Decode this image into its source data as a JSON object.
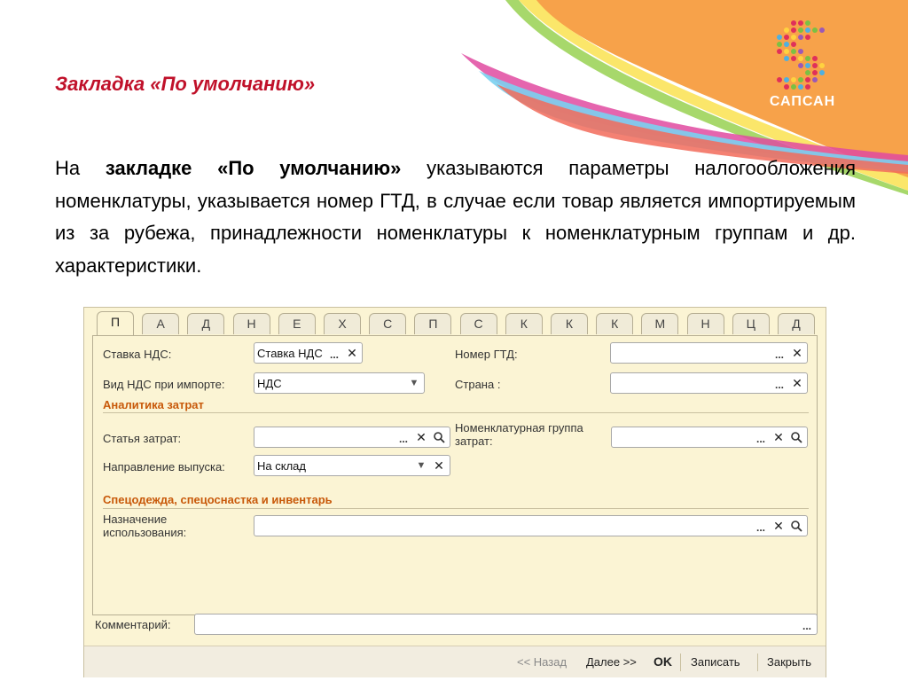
{
  "slide": {
    "title": "Закладка «По умолчанию»",
    "intro_prefix": "На ",
    "intro_bold": "закладке «По умолчанию»",
    "intro_rest": " указываются параметры налогообложения номенклатуры, указывается номер ГТД, в случае если товар является импортируемым из за рубежа, принадлежности номенклатуры к номенклатурным группам и др. характеристики."
  },
  "logo": {
    "text": "САПСАН"
  },
  "tabs": [
    "П",
    "А",
    "Д",
    "Н",
    "Е",
    "Х",
    "С",
    "П",
    "С",
    "К",
    "К",
    "К",
    "М",
    "Н",
    "Ц",
    "Д"
  ],
  "form": {
    "vat_rate": {
      "label": "Ставка НДС:",
      "value": "Ставка НДС"
    },
    "vat_import": {
      "label": "Вид НДС при импорте:",
      "value": "НДС"
    },
    "gtd_number": {
      "label": "Номер ГТД:",
      "value": ""
    },
    "country": {
      "label": "Страна :",
      "value": ""
    },
    "cost_section": "Аналитика затрат",
    "cost_item": {
      "label": "Статья затрат:",
      "value": ""
    },
    "nomen_group": {
      "label": "Номенклатурная группа затрат:",
      "value": ""
    },
    "direction": {
      "label": "Направление выпуска:",
      "value": "На склад"
    },
    "workwear_section": "Спецодежда, спецоснастка и инвентарь",
    "purpose": {
      "label": "Назначение использования:",
      "value": ""
    },
    "comment": {
      "label": "Комментарий:",
      "value": ""
    }
  },
  "buttons": {
    "back": "<< Назад",
    "next": "Далее >>",
    "ok": "OK",
    "save": "Записать",
    "close": "Закрыть"
  },
  "icons": {
    "more": "...",
    "clear": "✕",
    "dropdown": "▼",
    "search": "magnifier"
  }
}
